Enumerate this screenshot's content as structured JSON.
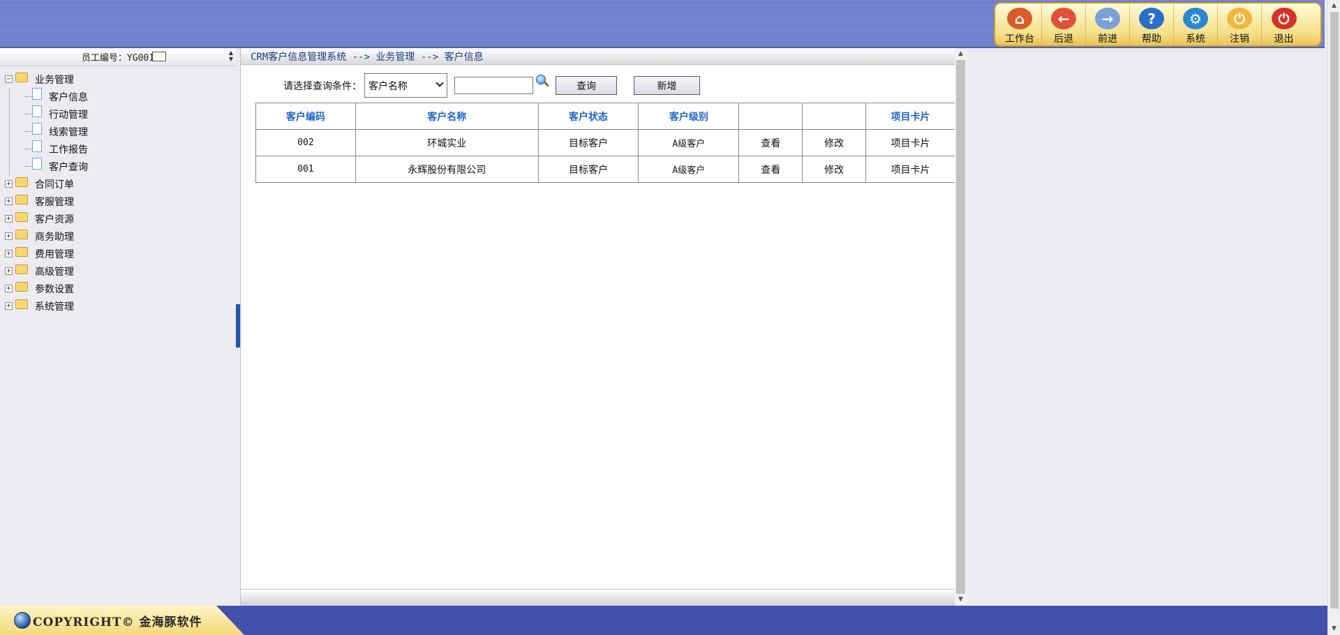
{
  "toolbar": {
    "items": [
      {
        "label": "工作台",
        "icon": "home-icon",
        "color": "#d95b2a"
      },
      {
        "label": "后退",
        "icon": "back-arrow-icon",
        "color": "#e2503c"
      },
      {
        "label": "前进",
        "icon": "forward-arrow-icon",
        "color": "#7aa0d8"
      },
      {
        "label": "帮助",
        "icon": "help-icon",
        "color": "#2a6fc8"
      },
      {
        "label": "系统",
        "icon": "gear-icon",
        "color": "#2a88d0"
      },
      {
        "label": "注销",
        "icon": "logoff-icon",
        "color": "#f0b640"
      },
      {
        "label": "退出",
        "icon": "power-icon",
        "color": "#d8302a"
      }
    ]
  },
  "sidebar": {
    "employee_label": "员工编号：YG001",
    "tree": [
      {
        "label": "业务管理",
        "expanded": true,
        "children": [
          "客户信息",
          "行动管理",
          "线索管理",
          "工作报告",
          "客户查询"
        ]
      },
      {
        "label": "合同订单",
        "expanded": false
      },
      {
        "label": "客服管理",
        "expanded": false
      },
      {
        "label": "客户资源",
        "expanded": false
      },
      {
        "label": "商务助理",
        "expanded": false
      },
      {
        "label": "费用管理",
        "expanded": false
      },
      {
        "label": "高级管理",
        "expanded": false
      },
      {
        "label": "参数设置",
        "expanded": false
      },
      {
        "label": "系统管理",
        "expanded": false
      }
    ]
  },
  "breadcrumb": "CRM客户信息管理系统 --> 业务管理 --> 客户信息",
  "query": {
    "label": "请选择查询条件：",
    "selected": "客户名称",
    "input_value": "",
    "search_button": "查询",
    "add_button": "新增"
  },
  "table": {
    "headers": [
      "客户编码",
      "客户名称",
      "客户状态",
      "客户级别",
      "",
      "",
      "项目卡片"
    ],
    "rows": [
      [
        "002",
        "环城实业",
        "目标客户",
        "A级客户",
        "查看",
        "修改",
        "项目卡片"
      ],
      [
        "001",
        "永辉股份有限公司",
        "目标客户",
        "A级客户",
        "查看",
        "修改",
        "项目卡片"
      ]
    ]
  },
  "footer": {
    "copyright": "COPYRIGHT© 金海豚软件"
  },
  "colors": {
    "header_blue": "#6c7ccb",
    "toolbar_gold": "#f6e08a",
    "table_header_text": "#1e64c8",
    "footer_blue": "#3e4ca8"
  }
}
